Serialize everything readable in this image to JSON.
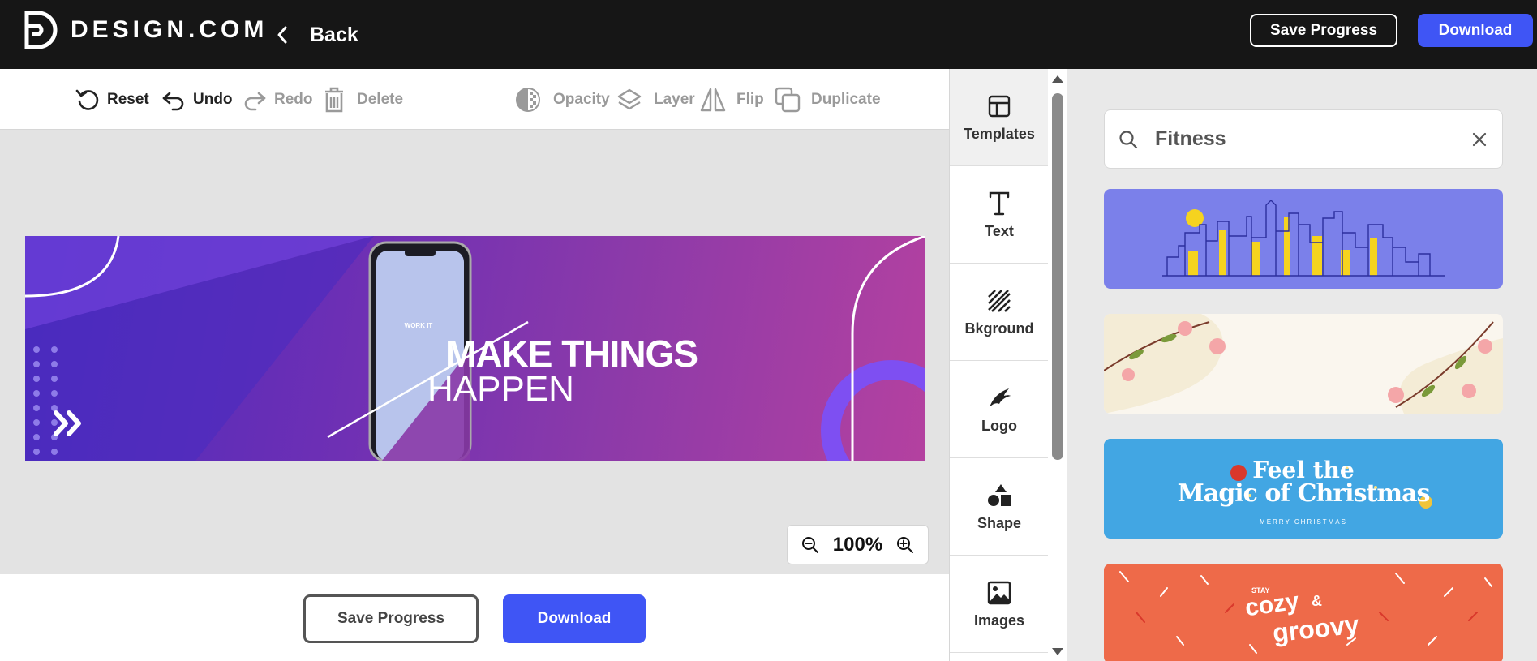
{
  "header": {
    "brand": "DESIGN.COM",
    "back_label": "Back",
    "save_progress": "Save Progress",
    "download": "Download"
  },
  "toolbar": {
    "reset": "Reset",
    "undo": "Undo",
    "redo": "Redo",
    "delete": "Delete",
    "opacity": "Opacity",
    "layer": "Layer",
    "flip": "Flip",
    "duplicate": "Duplicate"
  },
  "canvas": {
    "phone_text": "WORK IT",
    "headline_1": "MAKE THINGS",
    "headline_2": "HAPPEN",
    "zoom": "100%"
  },
  "bottom": {
    "save_progress": "Save Progress",
    "download": "Download"
  },
  "sidebar": {
    "items": [
      {
        "label": "Templates",
        "icon": "template-icon",
        "active": true
      },
      {
        "label": "Text",
        "icon": "text-icon"
      },
      {
        "label": "Bkground",
        "icon": "background-icon"
      },
      {
        "label": "Logo",
        "icon": "logo-icon"
      },
      {
        "label": "Shape",
        "icon": "shape-icon"
      },
      {
        "label": "Images",
        "icon": "image-icon"
      }
    ]
  },
  "panel": {
    "search_value": "Fitness",
    "templates": [
      {
        "name": "city-skyline",
        "bg": "#7b80ea"
      },
      {
        "name": "floral-branches",
        "bg": "#faf6ee"
      },
      {
        "name": "christmas",
        "bg": "#42a6e3",
        "text_1": "Feel the",
        "text_2": "Magic of Christmas",
        "text_3": "MERRY CHRISTMAS"
      },
      {
        "name": "cozy-groovy",
        "bg": "#ee6a49",
        "text_1": "STAY",
        "text_2": "cozy",
        "text_3": "&",
        "text_4": "groovy"
      }
    ]
  },
  "colors": {
    "accent": "#3f55f5",
    "topbar": "#161616"
  }
}
